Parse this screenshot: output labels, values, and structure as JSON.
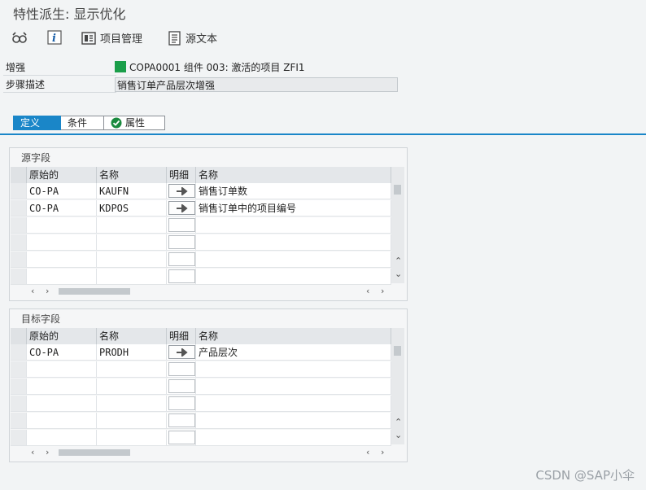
{
  "title": "特性派生: 显示优化",
  "toolbar": {
    "project_mgmt": "项目管理",
    "source_text": "源文本"
  },
  "fields": {
    "enhancement_label": "增强",
    "enhancement_value": "COPA0001 组件 003: 激活的项目 ZFI1",
    "step_label": "步骤描述",
    "step_value": "销售订单产品层次增强"
  },
  "tabs": {
    "definition": "定义",
    "conditions": "条件",
    "attributes": "属性"
  },
  "source_panel": {
    "title": "源字段",
    "headers": {
      "origin": "原始的",
      "name": "名称",
      "detail": "明细",
      "desc": "名称"
    },
    "rows": [
      {
        "origin": "CO-PA",
        "name": "KAUFN",
        "desc": "销售订单数"
      },
      {
        "origin": "CO-PA",
        "name": "KDPOS",
        "desc": "销售订单中的项目编号"
      }
    ]
  },
  "target_panel": {
    "title": "目标字段",
    "headers": {
      "origin": "原始的",
      "name": "名称",
      "detail": "明细",
      "desc": "名称"
    },
    "rows": [
      {
        "origin": "CO-PA",
        "name": "PRODH",
        "desc": "产品层次"
      }
    ]
  },
  "watermark": "CSDN @SAP小伞",
  "colors": {
    "accent": "#1a86c8",
    "active_indicator": "#1a9e49"
  },
  "icons": [
    "glasses-icon",
    "info-icon",
    "project-management-icon",
    "source-text-icon",
    "check-icon",
    "arrow-right-icon",
    "chevron-left-icon",
    "chevron-right-icon",
    "chevron-up-icon",
    "chevron-down-icon"
  ]
}
